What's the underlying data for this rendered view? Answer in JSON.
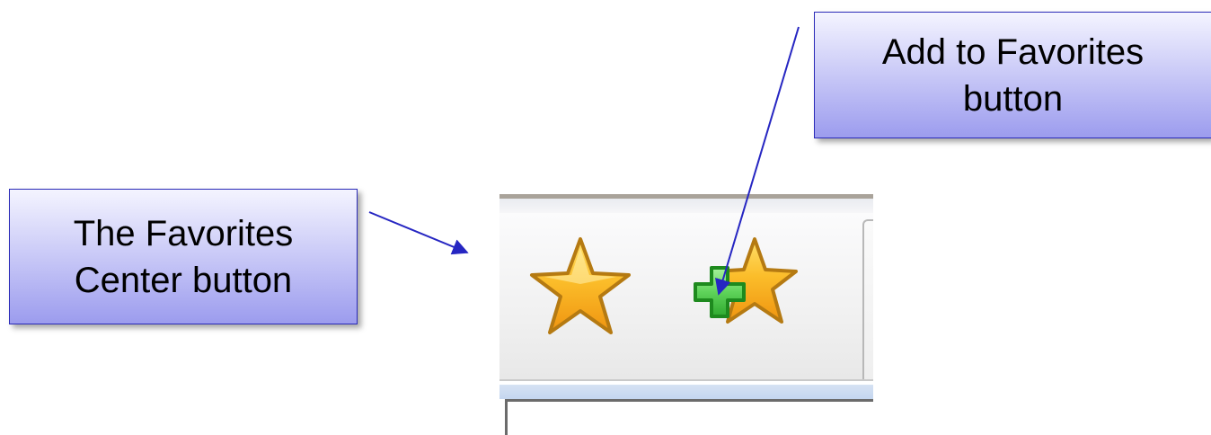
{
  "callouts": {
    "add_to_favorites": {
      "line1": "Add to Favorites",
      "line2": "button"
    },
    "favorites_center": {
      "line1": "The Favorites",
      "line2": "Center button"
    }
  },
  "toolbar": {
    "buttons": [
      {
        "icon": "favorites-star-icon"
      },
      {
        "icon": "add-to-favorites-icon"
      }
    ]
  },
  "colors": {
    "callout_border": "#2b2bb8",
    "callout_fill": "#c4c4f6",
    "arrow": "#2626c2",
    "star_gold": "#f6a21a",
    "plus_green": "#39b239"
  }
}
